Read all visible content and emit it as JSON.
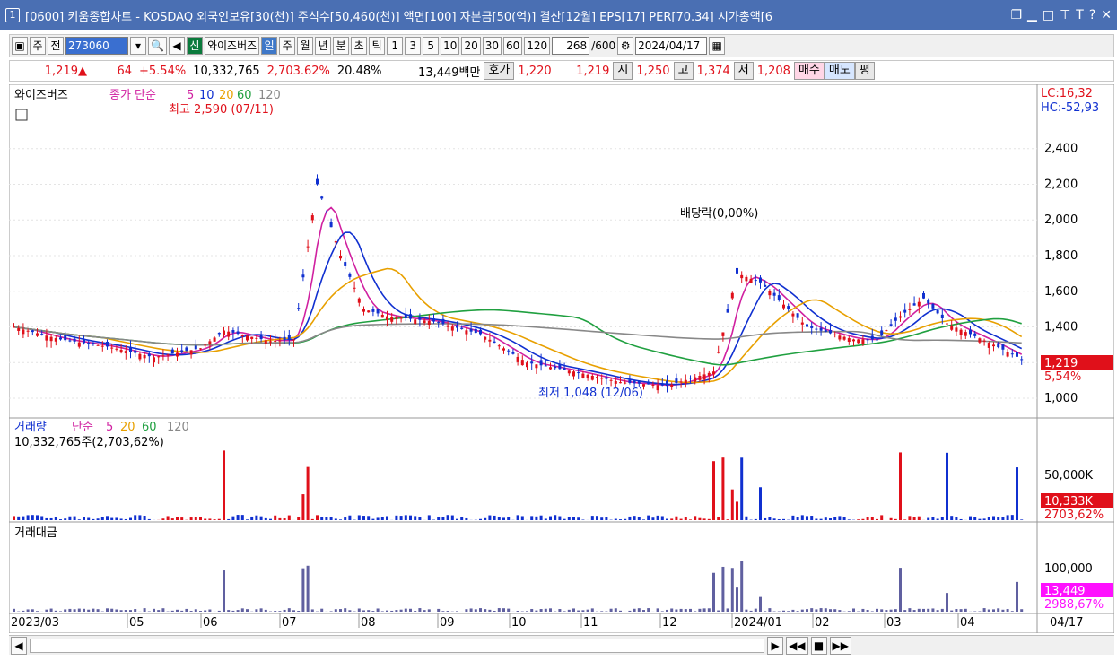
{
  "titlebar": {
    "num": "1",
    "title": "[0600] 키움종합차트 - KOSDAQ 외국인보유[30(천)] 주식수[50,460(천)] 액면[100] 자본금[50(억)] 결산[12월] EPS[17] PER[70.34] 시가총액[6"
  },
  "toolbar": {
    "period": "주",
    "prev": "전",
    "code": "273060",
    "name": "와이즈버즈",
    "sin": "신",
    "day": "일",
    "week": "주",
    "month": "월",
    "year": "년",
    "min": "분",
    "sec": "초",
    "tick": "틱",
    "ticks": [
      "1",
      "3",
      "5",
      "10",
      "20",
      "30",
      "60",
      "120"
    ],
    "count": "268",
    "max": "/600",
    "date": "2024/04/17"
  },
  "info": {
    "price": "1,219▲",
    "change": "64",
    "pct": "+5.54%",
    "volume": "10,332,765",
    "vol_pct": "2,703.62%",
    "turnover": "20.48%",
    "amount": "13,449백만",
    "hoga_label": "호가",
    "ask": "1,220",
    "bid": "1,219",
    "open_label": "시",
    "open": "1,250",
    "high_label": "고",
    "high": "1,374",
    "low_label": "저",
    "low": "1,208",
    "buy": "매수",
    "sell": "매도",
    "avg": "평"
  },
  "main": {
    "legend_name": "와이즈버즈",
    "legend_ma": "종가 단순",
    "ma": [
      "5",
      "10",
      "20",
      "60",
      "120"
    ],
    "lc": "LC:16,32",
    "hc": "HC:-52,93",
    "max_label": "최고 2,590 (07/11)",
    "min_label": "최저 1,048 (12/06)",
    "div_label": "배당락(0,00%)",
    "price_tag": "1,219",
    "pct_tag": "5,54%",
    "yticks": [
      "2,400",
      "2,200",
      "2,000",
      "1,800",
      "1,600",
      "1,400",
      "1,200",
      "1,000"
    ]
  },
  "vol": {
    "title": "거래량",
    "ma_label": "단순",
    "ma": [
      "5",
      "20",
      "60",
      "120"
    ],
    "line": "10,332,765주(2,703,62%)",
    "tick": "50,000K",
    "tag": "10,333K",
    "tag2": "2703,62%"
  },
  "amt": {
    "title": "거래대금",
    "tick": "100,000",
    "tag": "13,449",
    "tag2": "2988,67%"
  },
  "xaxis": [
    "2023/03",
    "05",
    "06",
    "07",
    "08",
    "09",
    "10",
    "11",
    "12",
    "2024/01",
    "02",
    "03",
    "04"
  ],
  "xend": "04/17",
  "chart_data": {
    "type": "candlestick",
    "ylim": [
      950,
      2650
    ],
    "close_series": [
      [
        0,
        1400
      ],
      [
        10,
        1330
      ],
      [
        20,
        1290
      ],
      [
        30,
        1230
      ],
      [
        40,
        1280
      ],
      [
        45,
        1380
      ],
      [
        55,
        1320
      ],
      [
        60,
        1330
      ],
      [
        65,
        2200
      ],
      [
        70,
        1800
      ],
      [
        75,
        1500
      ],
      [
        80,
        1460
      ],
      [
        90,
        1430
      ],
      [
        100,
        1360
      ],
      [
        110,
        1200
      ],
      [
        120,
        1150
      ],
      [
        130,
        1090
      ],
      [
        140,
        1070
      ],
      [
        150,
        1150
      ],
      [
        155,
        1700
      ],
      [
        160,
        1650
      ],
      [
        170,
        1400
      ],
      [
        180,
        1330
      ],
      [
        185,
        1330
      ],
      [
        190,
        1460
      ],
      [
        195,
        1560
      ],
      [
        200,
        1420
      ],
      [
        210,
        1300
      ],
      [
        216,
        1219
      ]
    ]
  }
}
